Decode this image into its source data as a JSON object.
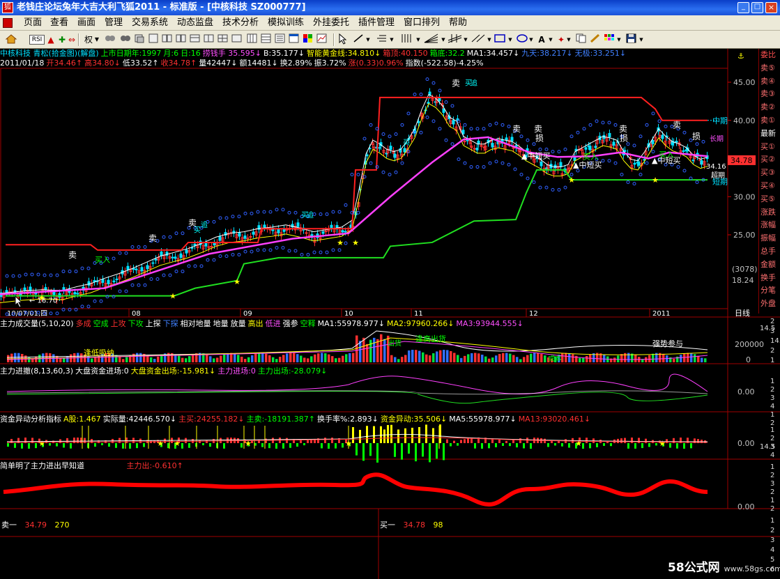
{
  "window": {
    "title": "老钱庄论坛兔年大吉大利飞狐2011 - 标准版 - [中核科技 SZ000777]"
  },
  "menu": [
    "页面",
    "查看",
    "画面",
    "管理",
    "交易系统",
    "动态监盘",
    "技术分析",
    "模拟训练",
    "外挂委托",
    "插件管理",
    "窗口排列",
    "帮助"
  ],
  "toolbar": {
    "rights": "权",
    "rsi": "RSI"
  },
  "main_info": {
    "row1": [
      {
        "t": "中核科技 青松(拾金图)(解盘)",
        "c": "#00e0ff"
      },
      {
        "t": "上市日期年:1997",
        "c": "#00ff00"
      },
      {
        "t": "月:6",
        "c": "#00ff00"
      },
      {
        "t": "日:16",
        "c": "#00ff00"
      },
      {
        "t": "捞钱手 35.595↓",
        "c": "#ff50ff"
      },
      {
        "t": "B:35.177↓",
        "c": "#ffffff"
      },
      {
        "t": "智能黄金线:34.810↓",
        "c": "#ffff00"
      },
      {
        "t": "箱顶:40.150",
        "c": "#ff3030"
      },
      {
        "t": "箱底:32.2",
        "c": "#00ff00"
      },
      {
        "t": "MA1:34.457↓",
        "c": "#ffffff"
      },
      {
        "t": "九天:38.217↓",
        "c": "#4080ff"
      },
      {
        "t": "无极:33.251↓",
        "c": "#4080ff"
      }
    ],
    "row2": [
      {
        "t": "2011/01/18",
        "c": "#ffffff"
      },
      {
        "t": "开34.46↑",
        "c": "#ff3030"
      },
      {
        "t": "高34.80↓",
        "c": "#ff3030"
      },
      {
        "t": "低33.52↑",
        "c": "#ffffff"
      },
      {
        "t": "收34.78↑",
        "c": "#ff3030"
      },
      {
        "t": "量42447↓",
        "c": "#ffffff"
      },
      {
        "t": "额14481↓",
        "c": "#ffffff"
      },
      {
        "t": "换2.89%",
        "c": "#ffffff"
      },
      {
        "t": "振3.72%",
        "c": "#ffffff"
      },
      {
        "t": "涨(0.33)0.96%",
        "c": "#ff3030"
      },
      {
        "t": "指数(-522.58)-4.25%",
        "c": "#ffffff"
      }
    ]
  },
  "price_axis": {
    "labels": [
      "45.00",
      "40.00",
      "35.00",
      "30.00",
      "25.00"
    ],
    "current_price": "34.78",
    "info1": "(3078)",
    "info2": "18.24",
    "current_small": "34.16"
  },
  "line_tags": {
    "mid": "中期",
    "short": "短期",
    "long": "长期",
    "cycle": "超期"
  },
  "annotations": {
    "sell": "卖",
    "stop": "损",
    "buy": "买入",
    "mid_buy": "中短买",
    "fountain": "喷涌",
    "low_price": "16.70",
    "high_sell": "逢高出货",
    "strong": "强势参与",
    "low_buy": "逢低吸纳",
    "out": "出货",
    "cost": "成本",
    "buy2": "买",
    "chase": "追"
  },
  "time_axis": {
    "start": "10/07/01,四",
    "months": [
      "08",
      "09",
      "10",
      "11",
      "12",
      "2011"
    ],
    "period": "日线"
  },
  "rightpanel": [
    "委比",
    "卖⑤",
    "卖④",
    "卖③",
    "卖②",
    "卖①",
    "最新",
    "买①",
    "买②",
    "买③",
    "买④",
    "买⑤",
    "涨跌",
    "涨幅",
    "振幅",
    "总手",
    "金额",
    "换手",
    "分笔",
    "外盘"
  ],
  "side_numbers": {
    "p1": [
      "14.5",
      "2",
      "3",
      "4"
    ],
    "p2": [
      "1",
      "2",
      "3",
      "14.5",
      "2",
      "1"
    ]
  },
  "vol_panel": {
    "items": [
      {
        "t": "主力成交量(5,10,20)",
        "c": "#ffffff"
      },
      {
        "t": "多成",
        "c": "#ff3030"
      },
      {
        "t": "空成",
        "c": "#00ff00"
      },
      {
        "t": "上攻",
        "c": "#ff3030"
      },
      {
        "t": "下攻",
        "c": "#00ff00"
      },
      {
        "t": "上探",
        "c": "#ffffff"
      },
      {
        "t": "下探",
        "c": "#4080ff"
      },
      {
        "t": "相对地量",
        "c": "#ffffff"
      },
      {
        "t": "地量",
        "c": "#ffffff"
      },
      {
        "t": "放量",
        "c": "#ffffff"
      },
      {
        "t": "高出",
        "c": "#ffff00"
      },
      {
        "t": "低进",
        "c": "#ff50ff"
      },
      {
        "t": "强参",
        "c": "#ffffff"
      },
      {
        "t": "空释",
        "c": "#00ff00"
      },
      {
        "t": "MA1:55978.977↓",
        "c": "#ffffff"
      },
      {
        "t": "MA2:97960.266↓",
        "c": "#ffff00"
      },
      {
        "t": "MA3:93944.555↓",
        "c": "#ff50ff"
      }
    ],
    "axis": [
      "200000",
      "0"
    ]
  },
  "fund_panel": {
    "items": [
      {
        "t": "主力进撤(8,13,60,3)",
        "c": "#ffffff"
      },
      {
        "t": "大盘资金进场:0",
        "c": "#ffffff"
      },
      {
        "t": "大盘资金出场:-15.981↓",
        "c": "#ffff00"
      },
      {
        "t": "主力进场:0",
        "c": "#ff50ff"
      },
      {
        "t": "主力出场:-28.079↓",
        "c": "#00ff00"
      }
    ],
    "axis": "0.00"
  },
  "abnormal_panel": {
    "items": [
      {
        "t": "资金异动分析指标",
        "c": "#ffffff"
      },
      {
        "t": "A股:1.467",
        "c": "#ffff00"
      },
      {
        "t": "实际量:42446.570↓",
        "c": "#ffffff"
      },
      {
        "t": "主买:24255.182↓",
        "c": "#ff3030"
      },
      {
        "t": "主卖:-18191.387↑",
        "c": "#00ff00"
      },
      {
        "t": "换手率%:2.893↓",
        "c": "#ffffff"
      },
      {
        "t": "资金异动:35.506↓",
        "c": "#ffff00"
      },
      {
        "t": "MA5:55978.977↓",
        "c": "#ffffff"
      },
      {
        "t": "MA13:93020.461↓",
        "c": "#ff3030"
      }
    ],
    "axis": "0.00",
    "axis2": "14.5"
  },
  "main_force_panel": {
    "title": "简单明了主力进出早知道",
    "value": "主力出:-0.610↑",
    "axis": "0.00"
  },
  "bottom": {
    "sell1_label": "卖一",
    "sell1_price": "34.79",
    "sell1_vol": "270",
    "buy1_label": "买一",
    "buy1_price": "34.78",
    "buy1_vol": "98"
  },
  "watermark": {
    "text": "58公式网",
    "site": "www.58gs.com"
  }
}
